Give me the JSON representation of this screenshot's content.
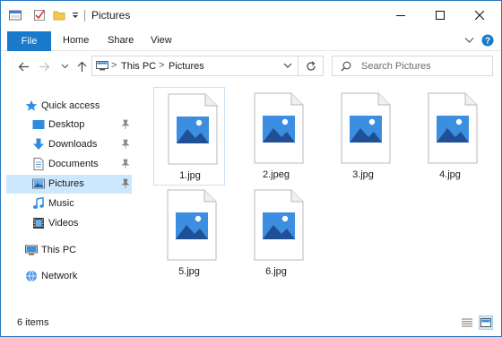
{
  "window": {
    "title": "Pictures",
    "accent": "#1979ca"
  },
  "ribbon": {
    "tabs": [
      "File",
      "Home",
      "Share",
      "View"
    ]
  },
  "address": {
    "crumbs": [
      "This PC",
      "Pictures"
    ],
    "separator": ">"
  },
  "search": {
    "placeholder": "Search Pictures"
  },
  "nav": {
    "items": [
      {
        "label": "Quick access",
        "icon": "star-icon"
      },
      {
        "label": "Desktop",
        "icon": "desktop-icon",
        "pinned": true
      },
      {
        "label": "Downloads",
        "icon": "download-arrow-icon",
        "pinned": true
      },
      {
        "label": "Documents",
        "icon": "document-icon",
        "pinned": true
      },
      {
        "label": "Pictures",
        "icon": "pictures-icon",
        "pinned": true,
        "selected": true
      },
      {
        "label": "Music",
        "icon": "music-note-icon"
      },
      {
        "label": "Videos",
        "icon": "film-icon"
      },
      {
        "label": "This PC",
        "icon": "computer-icon"
      },
      {
        "label": "Network",
        "icon": "network-icon"
      }
    ]
  },
  "files": [
    {
      "name": "1.jpg"
    },
    {
      "name": "2.jpeg"
    },
    {
      "name": "3.jpg"
    },
    {
      "name": "4.jpg"
    },
    {
      "name": "5.jpg"
    },
    {
      "name": "6.jpg"
    }
  ],
  "status": {
    "count": "6 items"
  }
}
